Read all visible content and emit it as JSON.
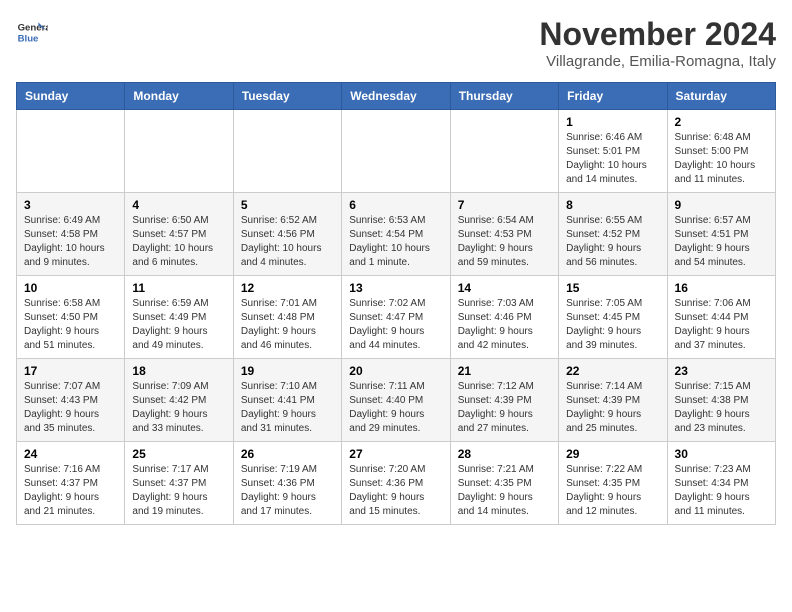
{
  "logo": {
    "general": "General",
    "blue": "Blue"
  },
  "title": "November 2024",
  "subtitle": "Villagrande, Emilia-Romagna, Italy",
  "days_of_week": [
    "Sunday",
    "Monday",
    "Tuesday",
    "Wednesday",
    "Thursday",
    "Friday",
    "Saturday"
  ],
  "weeks": [
    [
      {
        "day": "",
        "info": ""
      },
      {
        "day": "",
        "info": ""
      },
      {
        "day": "",
        "info": ""
      },
      {
        "day": "",
        "info": ""
      },
      {
        "day": "",
        "info": ""
      },
      {
        "day": "1",
        "info": "Sunrise: 6:46 AM\nSunset: 5:01 PM\nDaylight: 10 hours and 14 minutes."
      },
      {
        "day": "2",
        "info": "Sunrise: 6:48 AM\nSunset: 5:00 PM\nDaylight: 10 hours and 11 minutes."
      }
    ],
    [
      {
        "day": "3",
        "info": "Sunrise: 6:49 AM\nSunset: 4:58 PM\nDaylight: 10 hours and 9 minutes."
      },
      {
        "day": "4",
        "info": "Sunrise: 6:50 AM\nSunset: 4:57 PM\nDaylight: 10 hours and 6 minutes."
      },
      {
        "day": "5",
        "info": "Sunrise: 6:52 AM\nSunset: 4:56 PM\nDaylight: 10 hours and 4 minutes."
      },
      {
        "day": "6",
        "info": "Sunrise: 6:53 AM\nSunset: 4:54 PM\nDaylight: 10 hours and 1 minute."
      },
      {
        "day": "7",
        "info": "Sunrise: 6:54 AM\nSunset: 4:53 PM\nDaylight: 9 hours and 59 minutes."
      },
      {
        "day": "8",
        "info": "Sunrise: 6:55 AM\nSunset: 4:52 PM\nDaylight: 9 hours and 56 minutes."
      },
      {
        "day": "9",
        "info": "Sunrise: 6:57 AM\nSunset: 4:51 PM\nDaylight: 9 hours and 54 minutes."
      }
    ],
    [
      {
        "day": "10",
        "info": "Sunrise: 6:58 AM\nSunset: 4:50 PM\nDaylight: 9 hours and 51 minutes."
      },
      {
        "day": "11",
        "info": "Sunrise: 6:59 AM\nSunset: 4:49 PM\nDaylight: 9 hours and 49 minutes."
      },
      {
        "day": "12",
        "info": "Sunrise: 7:01 AM\nSunset: 4:48 PM\nDaylight: 9 hours and 46 minutes."
      },
      {
        "day": "13",
        "info": "Sunrise: 7:02 AM\nSunset: 4:47 PM\nDaylight: 9 hours and 44 minutes."
      },
      {
        "day": "14",
        "info": "Sunrise: 7:03 AM\nSunset: 4:46 PM\nDaylight: 9 hours and 42 minutes."
      },
      {
        "day": "15",
        "info": "Sunrise: 7:05 AM\nSunset: 4:45 PM\nDaylight: 9 hours and 39 minutes."
      },
      {
        "day": "16",
        "info": "Sunrise: 7:06 AM\nSunset: 4:44 PM\nDaylight: 9 hours and 37 minutes."
      }
    ],
    [
      {
        "day": "17",
        "info": "Sunrise: 7:07 AM\nSunset: 4:43 PM\nDaylight: 9 hours and 35 minutes."
      },
      {
        "day": "18",
        "info": "Sunrise: 7:09 AM\nSunset: 4:42 PM\nDaylight: 9 hours and 33 minutes."
      },
      {
        "day": "19",
        "info": "Sunrise: 7:10 AM\nSunset: 4:41 PM\nDaylight: 9 hours and 31 minutes."
      },
      {
        "day": "20",
        "info": "Sunrise: 7:11 AM\nSunset: 4:40 PM\nDaylight: 9 hours and 29 minutes."
      },
      {
        "day": "21",
        "info": "Sunrise: 7:12 AM\nSunset: 4:39 PM\nDaylight: 9 hours and 27 minutes."
      },
      {
        "day": "22",
        "info": "Sunrise: 7:14 AM\nSunset: 4:39 PM\nDaylight: 9 hours and 25 minutes."
      },
      {
        "day": "23",
        "info": "Sunrise: 7:15 AM\nSunset: 4:38 PM\nDaylight: 9 hours and 23 minutes."
      }
    ],
    [
      {
        "day": "24",
        "info": "Sunrise: 7:16 AM\nSunset: 4:37 PM\nDaylight: 9 hours and 21 minutes."
      },
      {
        "day": "25",
        "info": "Sunrise: 7:17 AM\nSunset: 4:37 PM\nDaylight: 9 hours and 19 minutes."
      },
      {
        "day": "26",
        "info": "Sunrise: 7:19 AM\nSunset: 4:36 PM\nDaylight: 9 hours and 17 minutes."
      },
      {
        "day": "27",
        "info": "Sunrise: 7:20 AM\nSunset: 4:36 PM\nDaylight: 9 hours and 15 minutes."
      },
      {
        "day": "28",
        "info": "Sunrise: 7:21 AM\nSunset: 4:35 PM\nDaylight: 9 hours and 14 minutes."
      },
      {
        "day": "29",
        "info": "Sunrise: 7:22 AM\nSunset: 4:35 PM\nDaylight: 9 hours and 12 minutes."
      },
      {
        "day": "30",
        "info": "Sunrise: 7:23 AM\nSunset: 4:34 PM\nDaylight: 9 hours and 11 minutes."
      }
    ]
  ]
}
